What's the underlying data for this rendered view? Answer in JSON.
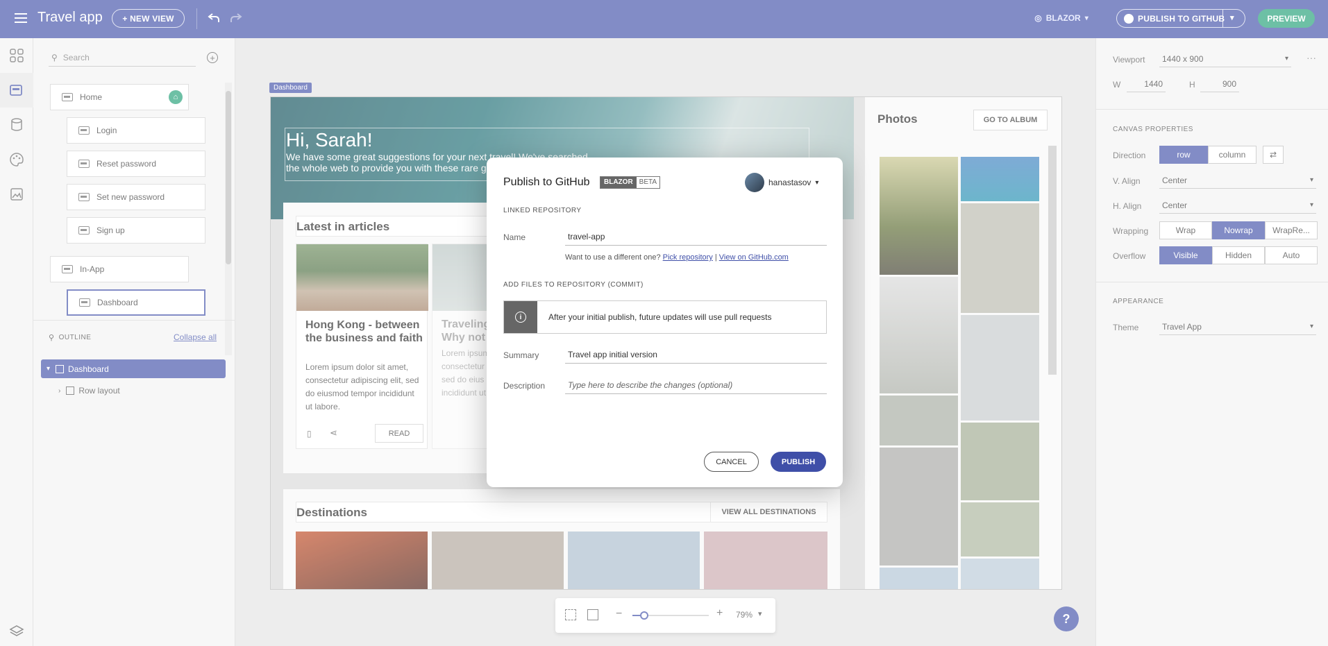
{
  "header": {
    "app_title": "Travel app",
    "new_view_label": "+ NEW VIEW",
    "framework_label": "BLAZOR",
    "publish_label": "PUBLISH TO GITHUB",
    "preview_label": "PREVIEW"
  },
  "panel": {
    "search_placeholder": "Search",
    "pages": [
      "Home",
      "Login",
      "Reset password",
      "Set new password",
      "Sign up",
      "In-App",
      "Dashboard"
    ],
    "outline_label": "OUTLINE",
    "collapse_all_label": "Collapse all",
    "tree": [
      "Dashboard",
      "Row layout"
    ]
  },
  "canvas": {
    "badge": "Dashboard",
    "greeting": "Hi, Sarah!",
    "subtitle_line1": "We have some great suggestions for your next travel! We've searched",
    "subtitle_line2": "the whole web to provide you with these rare gems",
    "latest_title": "Latest in articles",
    "article1_title": "Hong Kong - between the business and faith",
    "article1_body": "Lorem ipsum dolor sit amet, consectetur adipiscing elit, sed do eiusmod tempor incididunt ut labore.",
    "article1_action": "READ",
    "article2_title_line1": "Traveling",
    "article2_title_line2": "Why not",
    "article2_body": "Lorem ipsum consectetur sed do eius incididunt ut",
    "photos_title": "Photos",
    "album_label": "GO TO ALBUM",
    "destinations_title": "Destinations",
    "view_all_label": "VIEW ALL DESTINATIONS",
    "zoom": "79%",
    "zoom_level_fraction": 0.15
  },
  "right": {
    "viewport_label": "Viewport",
    "viewport_value": "1440 x 900",
    "w_label": "W",
    "w_value": "1440",
    "h_label": "H",
    "h_value": "900",
    "canvas_props_label": "CANVAS PROPERTIES",
    "direction_label": "Direction",
    "direction_options": [
      "row",
      "column"
    ],
    "valign_label": "V. Align",
    "valign_value": "Center",
    "halign_label": "H. Align",
    "halign_value": "Center",
    "wrapping_label": "Wrapping",
    "wrapping_options": [
      "Wrap",
      "Nowrap",
      "WrapRe..."
    ],
    "overflow_label": "Overflow",
    "overflow_options": [
      "Visible",
      "Hidden",
      "Auto"
    ],
    "appearance_label": "APPEARANCE",
    "theme_label": "Theme",
    "theme_value": "Travel App"
  },
  "modal": {
    "title": "Publish to GitHub",
    "badge_blazor": "BLAZOR",
    "badge_beta": "BETA",
    "user": "hanastasov",
    "linked_repo_label": "LINKED REPOSITORY",
    "name_label": "Name",
    "name_value": "travel-app",
    "diff_text": "Want to use a different one?",
    "pick_repo_label": "Pick repository",
    "separator": "|",
    "view_github_label": "View on GitHub.com",
    "add_files_label": "ADD FILES TO REPOSITORY (COMMIT)",
    "info_text": "After your initial publish, future updates will use pull requests",
    "summary_label": "Summary",
    "summary_value": "Travel app initial version",
    "description_label": "Description",
    "description_placeholder": "Type here to describe the changes (optional)",
    "cancel_label": "CANCEL",
    "publish_label": "PUBLISH"
  },
  "colors": {
    "primary": "#3f4fa8",
    "preview_green": "#1f9e75"
  }
}
